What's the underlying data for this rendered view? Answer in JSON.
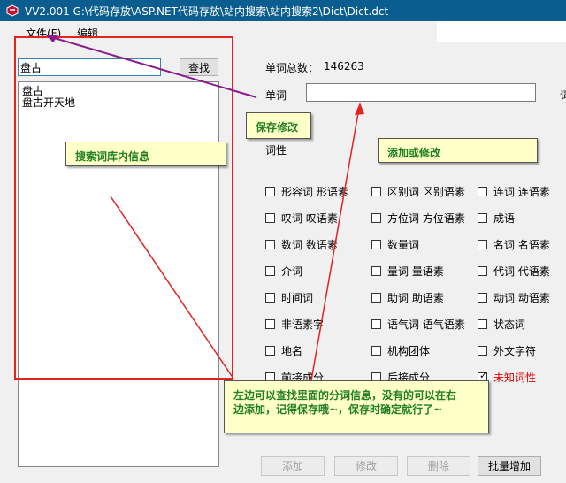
{
  "window": {
    "title": "VV2.001  G:\\代码存放\\ASP.NET代码存放\\站内搜索\\站内搜索2\\Dict\\Dict.dct"
  },
  "menu": {
    "file": "文件(F)",
    "edit": "编辑"
  },
  "search": {
    "value": "盘古",
    "button": "查找"
  },
  "results": [
    "盘古",
    "盘古开天地"
  ],
  "stats": {
    "label": "单词总数：",
    "value": "146263"
  },
  "word": {
    "label": "单词",
    "value": "",
    "edge_label": "词"
  },
  "pos": {
    "label": "词性",
    "checkboxes": [
      {
        "label": "形容词  形语素",
        "checked": false
      },
      {
        "label": "区别词  区别语素",
        "checked": false
      },
      {
        "label": "连词  连语素",
        "checked": false
      },
      {
        "label": "叹词  叹语素",
        "checked": false
      },
      {
        "label": "方位词  方位语素",
        "checked": false
      },
      {
        "label": "成语",
        "checked": false
      },
      {
        "label": "数词  数语素",
        "checked": false
      },
      {
        "label": "数量词",
        "checked": false
      },
      {
        "label": "名词  名语素",
        "checked": false
      },
      {
        "label": "介词",
        "checked": false
      },
      {
        "label": "量词  量语素",
        "checked": false
      },
      {
        "label": "代词  代语素",
        "checked": false
      },
      {
        "label": "时间词",
        "checked": false
      },
      {
        "label": "助词  助语素",
        "checked": false
      },
      {
        "label": "动词  动语素",
        "checked": false
      },
      {
        "label": "非语素字",
        "checked": false
      },
      {
        "label": "语气词  语气语素",
        "checked": false
      },
      {
        "label": "状态词",
        "checked": false
      },
      {
        "label": "地名",
        "checked": false
      },
      {
        "label": "机构团体",
        "checked": false
      },
      {
        "label": "外文字符",
        "checked": false
      },
      {
        "label": "前接成分",
        "checked": false
      },
      {
        "label": "后接成分",
        "checked": false
      },
      {
        "label": "未知词性",
        "checked": true
      }
    ]
  },
  "buttons": {
    "add": "添加",
    "modify": "修改",
    "delete": "删除",
    "batch_add": "批量增加"
  },
  "notes": {
    "save": "保存修改",
    "search_info": "搜索词库内信息",
    "add_modify": "添加或修改",
    "help_line1": "左边可以查找里面的分词信息，没有的可以在右",
    "help_line2": "边添加，记得保存哦~，保存时确定就行了~"
  },
  "colors": {
    "annotation_border": "#e32222",
    "note_bg": "#ffffc8",
    "note_text": "#208020",
    "arrow_purple": "#8b1a8b"
  }
}
